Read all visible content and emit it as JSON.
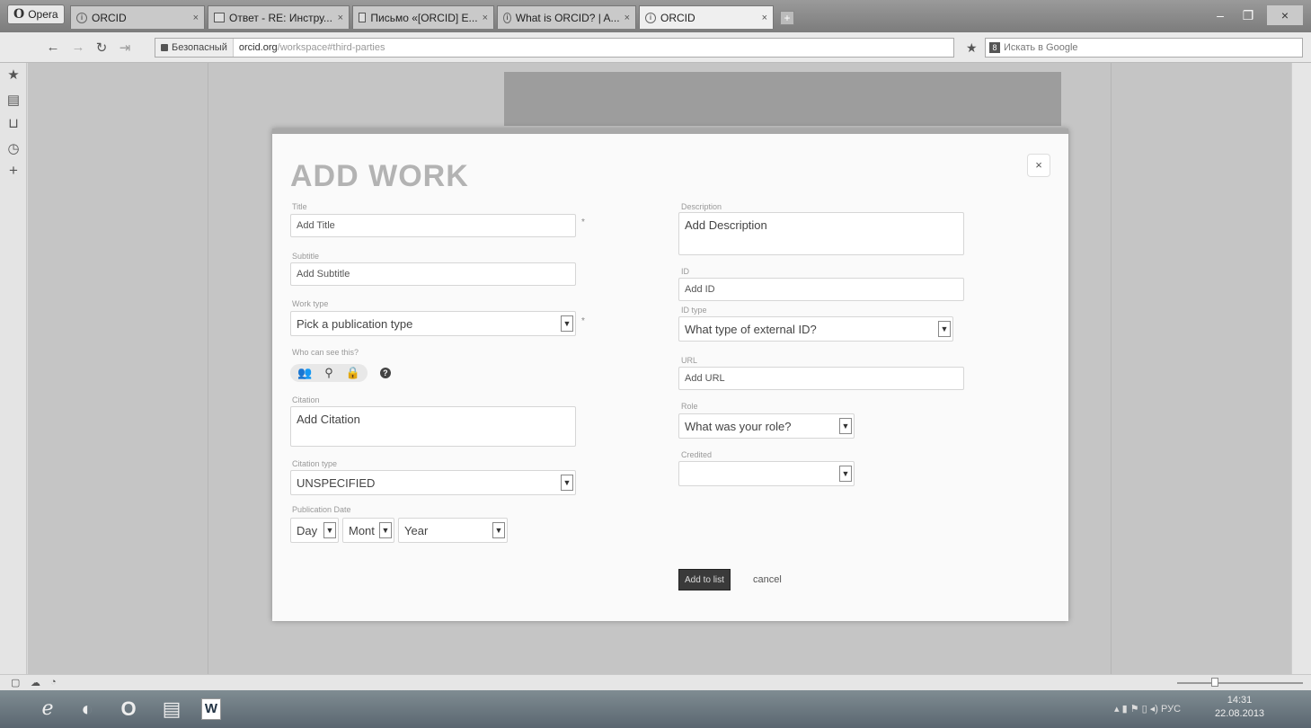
{
  "browser": {
    "menu_label": "Opera",
    "tabs": [
      {
        "title": "ORCID",
        "close": "×"
      },
      {
        "title": "Ответ - RE: Инстру...",
        "close": "×"
      },
      {
        "title": "Письмо «[ORCID] E...",
        "close": "×"
      },
      {
        "title": "What is ORCID? | A...",
        "close": "×"
      },
      {
        "title": "ORCID",
        "close": "×"
      }
    ],
    "new_tab": "+",
    "window_controls": {
      "minimize": "–",
      "restore": "❐",
      "close": "×"
    },
    "secure_label": "Безопасный",
    "url_host": "orcid.org",
    "url_path": "/workspace#third-parties",
    "search_placeholder": "Искать в Google",
    "search_engine_letter": "8"
  },
  "sidebar_icons": [
    "star-icon",
    "notes-icon",
    "bookmarks-icon",
    "history-icon",
    "add-panel-icon"
  ],
  "modal": {
    "title": "ADD WORK",
    "close": "×",
    "left": {
      "title_label": "Title",
      "title_placeholder": "Add Title",
      "subtitle_label": "Subtitle",
      "subtitle_placeholder": "Add Subtitle",
      "work_type_label": "Work type",
      "work_type_value": "Pick a publication type",
      "visibility_label": "Who can see this?",
      "citation_label": "Citation",
      "citation_placeholder": "Add Citation",
      "citation_type_label": "Citation type",
      "citation_type_value": "UNSPECIFIED",
      "pub_date_label": "Publication Date",
      "day_value": "Day",
      "month_value": "Mont",
      "year_value": "Year",
      "required_mark": "*"
    },
    "right": {
      "description_label": "Description",
      "description_placeholder": "Add Description",
      "id_label": "ID",
      "id_placeholder": "Add ID",
      "id_type_label": "ID type",
      "id_type_value": "What type of external ID?",
      "url_label": "URL",
      "url_placeholder": "Add URL",
      "role_label": "Role",
      "role_value": "What was your role?",
      "credited_label": "Credited",
      "credited_value": ""
    },
    "add_button": "Add to list",
    "cancel": "cancel"
  },
  "taskbar": {
    "language": "РУС",
    "time": "14:31",
    "date": "22.08.2013"
  }
}
